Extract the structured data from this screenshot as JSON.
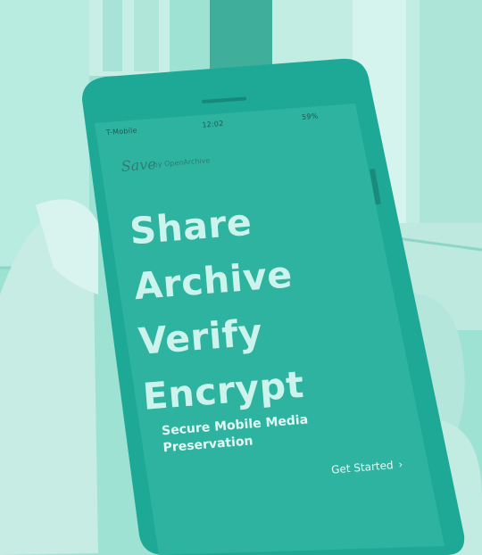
{
  "status_bar": {
    "carrier": "T-Mobile",
    "time": "12:02",
    "battery": "59%"
  },
  "brand": {
    "logo": "Save",
    "byline": "by OpenArchive"
  },
  "headline": [
    "Share",
    "Archive",
    "Verify",
    "Encrypt"
  ],
  "subtitle": "Secure Mobile Media Preservation",
  "cta": "Get Started",
  "colors": {
    "teal_tint": "#8fd9cb",
    "phone_body": "#1ea996",
    "screen": "#2fb3a1",
    "text": "#cdf4ec"
  },
  "icons": [
    "wifi-icon",
    "lock-icon",
    "chevron-right-icon"
  ]
}
